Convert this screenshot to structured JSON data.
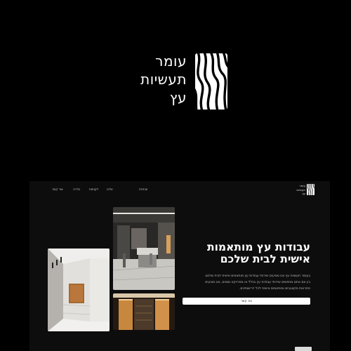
{
  "brand": {
    "logo_icon": "wood-grain-icon",
    "name_lines": [
      "עומר",
      "תעשיות",
      "עץ"
    ]
  },
  "nav": {
    "logo_lines": [
      "עומר",
      "תעשיות",
      "עץ"
    ],
    "items": [
      "עבודות",
      "עלינו",
      "לקוחות",
      "גלריה",
      "צור קשר"
    ]
  },
  "hero": {
    "title_line1": "עבודות עץ מותאמות",
    "title_line2": "אישית לבית שלכם",
    "text_line1": "בעומר תעשיות עץ אנו מציעים שירותי עבודות עץ מותאמים אישית לבית שלכם.",
    "text_line2": "בין אם אתם מחפשים שירותי עבודות עץ בכלל או מפרויקט מסוים, אנו מציעים",
    "text_line3": "פתרונות מקצועיים ומותאמים אישית לכל דרישותיכם.",
    "cta_label": "צור קשר"
  },
  "photos": [
    {
      "name": "kitchen-island-photo"
    },
    {
      "name": "hallway-cabinets-photo"
    },
    {
      "name": "lit-wood-closet-photo"
    }
  ],
  "colors": {
    "background": "#000000",
    "panel": "#0d0d0d",
    "accent": "#ffffff",
    "wood": "#b9773c"
  }
}
